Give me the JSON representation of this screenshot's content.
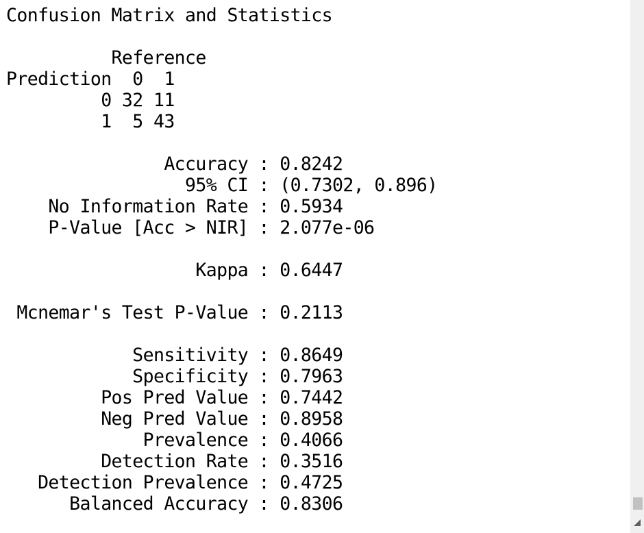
{
  "console": {
    "lines": [
      "Confusion Matrix and Statistics",
      "",
      "          Reference",
      "Prediction  0  1",
      "         0 32 11",
      "         1  5 43",
      "",
      "               Accuracy : 0.8242",
      "                 95% CI : (0.7302, 0.896)",
      "    No Information Rate : 0.5934",
      "    P-Value [Acc > NIR] : 2.077e-06",
      "",
      "                  Kappa : 0.6447",
      "",
      " Mcnemar's Test P-Value : 0.2113",
      "",
      "            Sensitivity : 0.8649",
      "            Specificity : 0.7963",
      "         Pos Pred Value : 0.7442",
      "         Neg Pred Value : 0.8958",
      "             Prevalence : 0.4066",
      "         Detection Rate : 0.3516",
      "   Detection Prevalence : 0.4725",
      "      Balanced Accuracy : 0.8306"
    ]
  },
  "scrollbar": {
    "position": 0.98,
    "icons": {
      "down": "scroll-down-arrow-icon"
    }
  }
}
